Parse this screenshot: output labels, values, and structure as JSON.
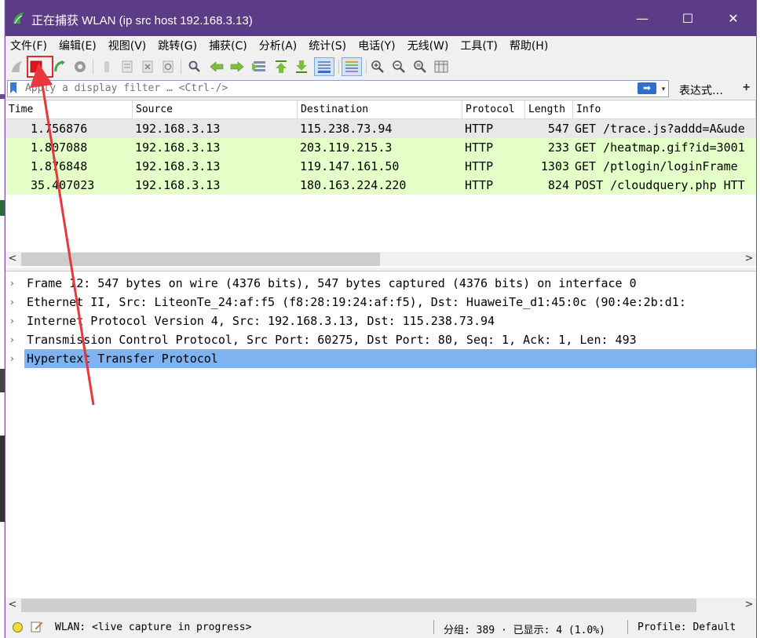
{
  "window": {
    "title": "正在捕获 WLAN (ip src host 192.168.3.13)",
    "controls": {
      "minimize": "—",
      "maximize": "☐",
      "close": "✕"
    }
  },
  "menu": [
    "文件(F)",
    "编辑(E)",
    "视图(V)",
    "跳转(G)",
    "捕获(C)",
    "分析(A)",
    "统计(S)",
    "电话(Y)",
    "无线(W)",
    "工具(T)",
    "帮助(H)"
  ],
  "toolbar": {
    "buttons": [
      {
        "name": "start-capture",
        "icon": "shark-fin-icon"
      },
      {
        "name": "stop-capture",
        "icon": "stop-square-icon",
        "highlighted": true
      },
      {
        "name": "restart-capture",
        "icon": "restart-icon"
      },
      {
        "name": "capture-options",
        "icon": "gear-icon"
      },
      {
        "name": "open-file",
        "icon": "open-file-icon"
      },
      {
        "name": "save-file",
        "icon": "save-file-icon"
      },
      {
        "name": "close-file",
        "icon": "close-file-icon"
      },
      {
        "name": "reload-file",
        "icon": "reload-icon"
      },
      {
        "name": "find-packet",
        "icon": "magnifier-icon"
      },
      {
        "name": "go-back",
        "icon": "arrow-left-icon"
      },
      {
        "name": "go-forward",
        "icon": "arrow-right-icon"
      },
      {
        "name": "go-to-packet",
        "icon": "goto-packet-icon"
      },
      {
        "name": "go-first",
        "icon": "arrow-up-icon"
      },
      {
        "name": "go-last",
        "icon": "arrow-down-icon"
      },
      {
        "name": "auto-scroll",
        "icon": "auto-scroll-icon"
      },
      {
        "name": "colorize",
        "icon": "colorize-icon"
      },
      {
        "name": "zoom-in",
        "icon": "zoom-in-icon"
      },
      {
        "name": "zoom-out",
        "icon": "zoom-out-icon"
      },
      {
        "name": "zoom-normal",
        "icon": "zoom-normal-icon"
      },
      {
        "name": "resize-columns",
        "icon": "resize-columns-icon"
      }
    ],
    "colors": {
      "stop": "#e0141c",
      "highlight_box": "#e0282d"
    }
  },
  "filter": {
    "placeholder": "Apply a display filter … <Ctrl-/>",
    "apply_icon": "➡",
    "dropdown_icon": "▾",
    "expression_label": "表达式…",
    "add_label": "+"
  },
  "packet_list": {
    "columns": [
      "Time",
      "Source",
      "Destination",
      "Protocol",
      "Length",
      "Info"
    ],
    "rows": [
      {
        "time": "1.756876",
        "source": "192.168.3.13",
        "destination": "115.238.73.94",
        "protocol": "HTTP",
        "length": "547",
        "info": "GET /trace.js?addd=A&ude"
      },
      {
        "time": "1.807088",
        "source": "192.168.3.13",
        "destination": "203.119.215.3",
        "protocol": "HTTP",
        "length": "233",
        "info": "GET /heatmap.gif?id=3001"
      },
      {
        "time": "1.876848",
        "source": "192.168.3.13",
        "destination": "119.147.161.50",
        "protocol": "HTTP",
        "length": "1303",
        "info": "GET /ptlogin/loginFrame"
      },
      {
        "time": "35.407023",
        "source": "192.168.3.13",
        "destination": "180.163.224.220",
        "protocol": "HTTP",
        "length": "824",
        "info": "POST /cloudquery.php HTT"
      }
    ],
    "row_colors": {
      "selected": "#e8e8e8",
      "http": "#e4ffc7"
    }
  },
  "details": {
    "rows": [
      "Frame 12: 547 bytes on wire (4376 bits), 547 bytes captured (4376 bits) on interface 0",
      "Ethernet II, Src: LiteonTe_24:af:f5 (f8:28:19:24:af:f5), Dst: HuaweiTe_d1:45:0c (90:4e:2b:d1:",
      "Internet Protocol Version 4, Src: 192.168.3.13, Dst: 115.238.73.94",
      "Transmission Control Protocol, Src Port: 60275, Dst Port: 80, Seq: 1, Ack: 1, Len: 493",
      "Hypertext Transfer Protocol"
    ],
    "selected_color": "#7fb2f0",
    "chevron": "›"
  },
  "scroll": {
    "left": "<",
    "right": ">"
  },
  "status": {
    "capture": "WLAN: <live capture in progress>",
    "packets": "分组: 389 · 已显示: 4 (1.0%)",
    "profile": "Profile: Default"
  }
}
